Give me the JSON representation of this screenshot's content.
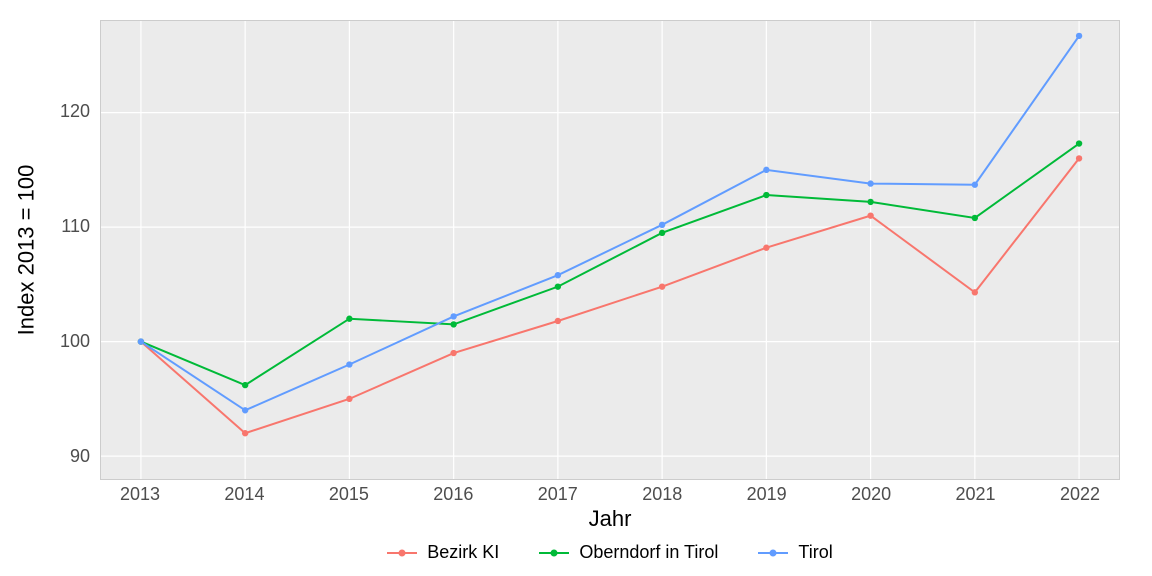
{
  "chart_data": {
    "type": "line",
    "xlabel": "Jahr",
    "ylabel": "Index  2013  =  100",
    "categories": [
      2013,
      2014,
      2015,
      2016,
      2017,
      2018,
      2019,
      2020,
      2021,
      2022
    ],
    "ylim": [
      88,
      128
    ],
    "yticks": [
      90,
      100,
      110,
      120
    ],
    "series": [
      {
        "name": "Bezirk KI",
        "color": "#f8766d",
        "values": [
          100,
          92.0,
          95.0,
          99.0,
          101.8,
          104.8,
          108.2,
          111.0,
          104.3,
          116.0
        ]
      },
      {
        "name": "Oberndorf in Tirol",
        "color": "#00ba38",
        "values": [
          100,
          96.2,
          102.0,
          101.5,
          104.8,
          109.5,
          112.8,
          112.2,
          110.8,
          117.3
        ]
      },
      {
        "name": "Tirol",
        "color": "#619cff",
        "values": [
          100,
          94.0,
          98.0,
          102.2,
          105.8,
          110.2,
          115.0,
          113.8,
          113.7,
          126.7
        ]
      }
    ],
    "legend_position": "bottom",
    "grid": true
  }
}
